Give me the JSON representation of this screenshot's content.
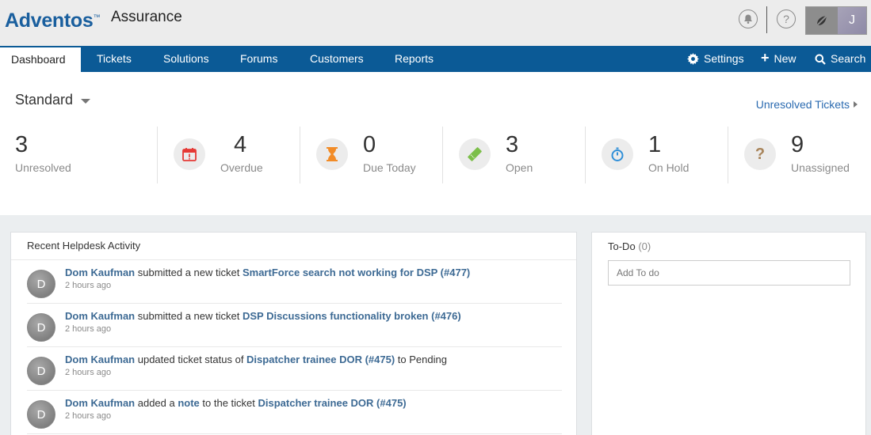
{
  "header": {
    "logo_text": "Adventos",
    "logo_tm": "™",
    "app_title": "Assurance",
    "avatar_initial": "J"
  },
  "nav": {
    "tabs": [
      {
        "label": "Dashboard",
        "active": true
      },
      {
        "label": "Tickets"
      },
      {
        "label": "Solutions"
      },
      {
        "label": "Forums"
      },
      {
        "label": "Customers"
      },
      {
        "label": "Reports"
      }
    ],
    "settings_label": "Settings",
    "new_label": "New",
    "search_label": "Search"
  },
  "dashboard": {
    "view_name": "Standard",
    "view_link": "Unresolved Tickets",
    "stats": [
      {
        "count": "3",
        "label": "Unresolved"
      },
      {
        "count": "4",
        "label": "Overdue",
        "icon": "calendar-icon",
        "color": "#e53935"
      },
      {
        "count": "0",
        "label": "Due Today",
        "icon": "hourglass-icon",
        "color": "#f28c28"
      },
      {
        "count": "3",
        "label": "Open",
        "icon": "ticket-icon",
        "color": "#7cbf4a"
      },
      {
        "count": "1",
        "label": "On Hold",
        "icon": "stopwatch-icon",
        "color": "#2f8fd8"
      },
      {
        "count": "9",
        "label": "Unassigned",
        "icon": "question-icon",
        "color": "#a8845a"
      }
    ]
  },
  "activity": {
    "title": "Recent Helpdesk Activity",
    "items": [
      {
        "initial": "D",
        "user": "Dom Kaufman",
        "action": " submitted a new ticket ",
        "target": "SmartForce search not working for DSP (#477)",
        "time": "2 hours ago"
      },
      {
        "initial": "D",
        "user": "Dom Kaufman",
        "action": " submitted a new ticket ",
        "target": "DSP Discussions functionality broken (#476)",
        "time": "2 hours ago"
      },
      {
        "initial": "D",
        "user": "Dom Kaufman",
        "action": " updated ticket status of ",
        "target": "Dispatcher trainee DOR (#475)",
        "suffix": " to Pending",
        "time": "2 hours ago"
      },
      {
        "initial": "D",
        "user": "Dom Kaufman",
        "action": " added a ",
        "link2": "note",
        "action2": " to the ticket ",
        "target": "Dispatcher trainee DOR (#475)",
        "time": "2 hours ago"
      }
    ]
  },
  "todo": {
    "title": "To-Do",
    "count": "(0)",
    "placeholder": "Add To do"
  },
  "colors": {
    "brand_blue": "#0b5a96",
    "link_blue": "#3d6a94"
  }
}
